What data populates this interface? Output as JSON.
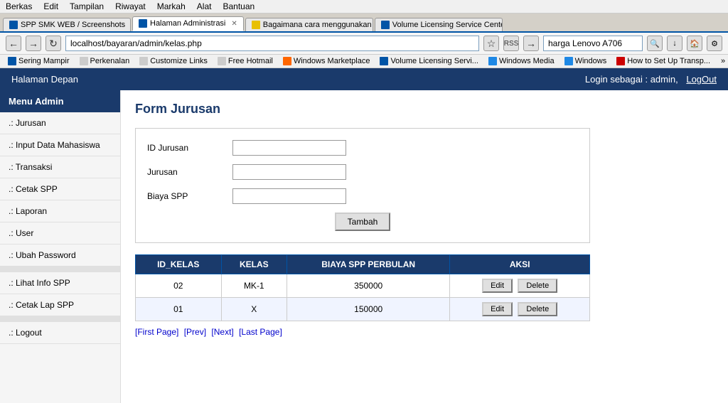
{
  "browser": {
    "menu_items": [
      "Berkas",
      "Edit",
      "Tampilan",
      "Riwayat",
      "Markah",
      "Alat",
      "Bantuan"
    ],
    "tabs": [
      {
        "id": "tab1",
        "label": "SPP SMK WEB / Screenshots",
        "favicon_color": "blue",
        "active": false
      },
      {
        "id": "tab2",
        "label": "Halaman Administrasi",
        "favicon_color": "blue",
        "active": true
      },
      {
        "id": "tab3",
        "label": "Bagaimana cara menggunakan mesin cuci...",
        "favicon_color": "yellow",
        "active": false
      },
      {
        "id": "tab4",
        "label": "Volume Licensing Service Center",
        "favicon_color": "ms",
        "active": false
      }
    ],
    "address": "localhost/bayaran/admin/kelas.php",
    "search_placeholder": "harga Lenovo A706",
    "bookmarks": [
      {
        "label": "Sering Mampir",
        "icon": "blue"
      },
      {
        "label": "Perkenalan",
        "icon": "blue"
      },
      {
        "label": "Customize Links",
        "icon": "blue"
      },
      {
        "label": "Free Hotmail",
        "icon": "blue"
      },
      {
        "label": "Windows Marketplace",
        "icon": "orange"
      },
      {
        "label": "Volume Licensing Servi...",
        "icon": "ms-color"
      },
      {
        "label": "Windows Media",
        "icon": "blue"
      },
      {
        "label": "Windows",
        "icon": "win"
      },
      {
        "label": "How to Set Up Transp...",
        "icon": "red"
      }
    ]
  },
  "app": {
    "header": {
      "title": "Halaman Depan",
      "login_text": "Login sebagai : admin,",
      "logout_label": "LogOut"
    },
    "sidebar": {
      "title": "Menu Admin",
      "items": [
        {
          "label": ".: Jurusan"
        },
        {
          "label": ".: Input Data Mahasiswa"
        },
        {
          "label": ".: Transaksi"
        },
        {
          "label": ".: Cetak SPP"
        },
        {
          "label": ".: Laporan"
        },
        {
          "label": ".: User"
        },
        {
          "label": ".: Ubah Password"
        },
        {
          "label": ".: Lihat Info SPP"
        },
        {
          "label": ".: Cetak Lap SPP"
        },
        {
          "label": ".: Logout"
        }
      ]
    },
    "content": {
      "form_title": "Form Jurusan",
      "form": {
        "fields": [
          {
            "label": "ID Jurusan",
            "placeholder": ""
          },
          {
            "label": "Jurusan",
            "placeholder": ""
          },
          {
            "label": "Biaya SPP",
            "placeholder": ""
          }
        ],
        "submit_label": "Tambah"
      },
      "table": {
        "headers": [
          "ID_KELAS",
          "KELAS",
          "BIAYA SPP PERBULAN",
          "AKSI"
        ],
        "rows": [
          {
            "id_kelas": "02",
            "kelas": "MK-1",
            "biaya": "350000"
          },
          {
            "id_kelas": "01",
            "kelas": "X",
            "biaya": "150000"
          }
        ],
        "edit_label": "Edit",
        "delete_label": "Delete"
      },
      "pagination": {
        "first": "[First Page]",
        "prev": "[Prev]",
        "next": "[Next]",
        "last": "[Last Page]"
      }
    }
  }
}
